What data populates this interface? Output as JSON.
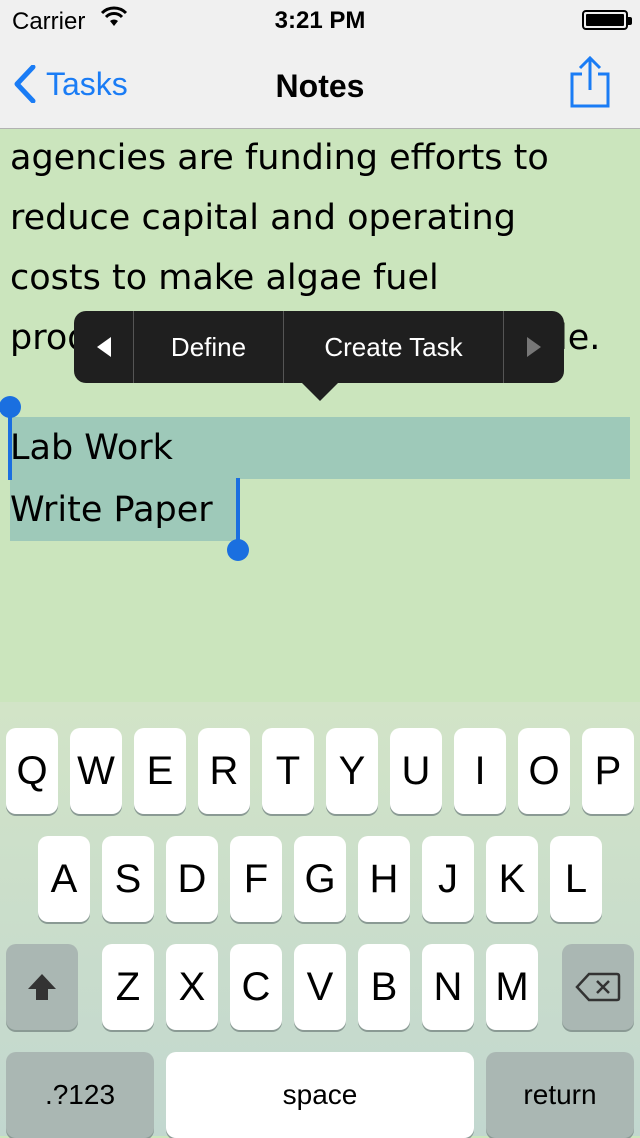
{
  "status_bar": {
    "carrier": "Carrier",
    "time": "3:21 PM"
  },
  "nav": {
    "back_label": "Tasks",
    "title": "Notes",
    "share_icon": "share-icon"
  },
  "notes": {
    "lines": [
      "agencies are funding efforts to",
      "reduce capital and operating",
      "costs to make algae fuel",
      "production"
    ],
    "line4_end": "le.",
    "selected_lines": [
      "Lab Work",
      "Write Paper"
    ]
  },
  "menu": {
    "prev_icon": "left-arrow-icon",
    "define": "Define",
    "create_task": "Create Task",
    "next_icon": "right-arrow-icon"
  },
  "keyboard": {
    "row1": [
      "Q",
      "W",
      "E",
      "R",
      "T",
      "Y",
      "U",
      "I",
      "O",
      "P"
    ],
    "row2": [
      "A",
      "S",
      "D",
      "F",
      "G",
      "H",
      "J",
      "K",
      "L"
    ],
    "row3": [
      "Z",
      "X",
      "C",
      "V",
      "B",
      "N",
      "M"
    ],
    "numbers": ".?123",
    "space": "space",
    "return": "return"
  },
  "colors": {
    "accent": "#1a7cf5",
    "note_bg": "#cbe5bd",
    "selection": "#9ec9b9"
  }
}
